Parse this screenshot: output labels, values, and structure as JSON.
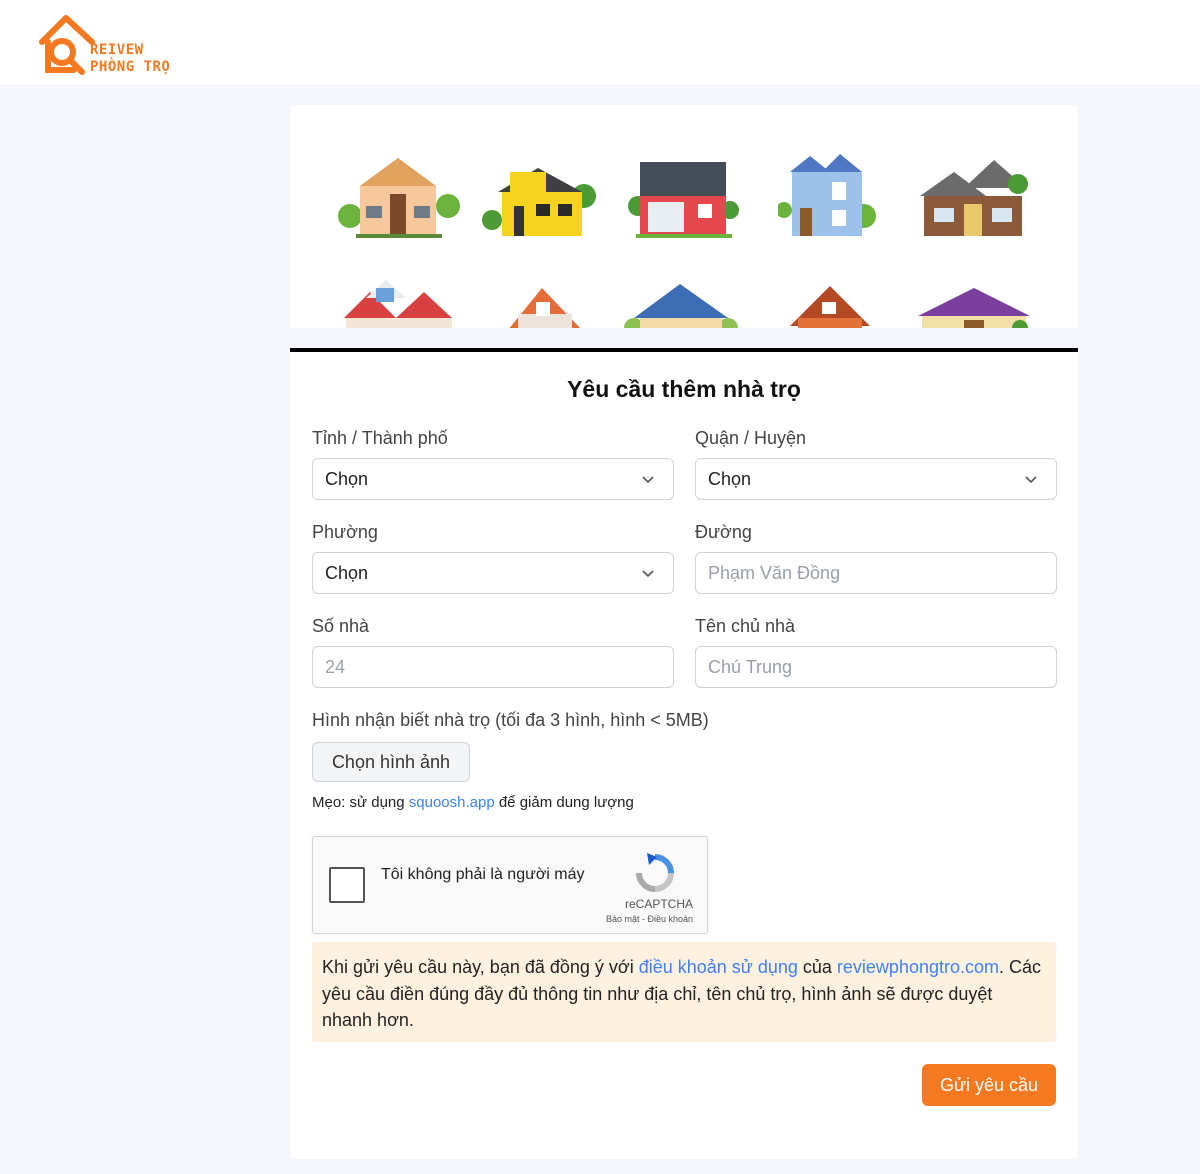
{
  "header": {
    "logo_line1": "REIVEW",
    "logo_line2": "PHÒNG TRỌ"
  },
  "form": {
    "title": "Yêu cầu thêm nhà trọ",
    "province": {
      "label": "Tỉnh / Thành phố",
      "value": "Chọn"
    },
    "district": {
      "label": "Quận / Huyện",
      "value": "Chọn"
    },
    "ward": {
      "label": "Phường",
      "value": "Chọn"
    },
    "street": {
      "label": "Đường",
      "placeholder": "Phạm Văn Đồng"
    },
    "house_number": {
      "label": "Số nhà",
      "placeholder": "24"
    },
    "owner": {
      "label": "Tên chủ nhà",
      "placeholder": "Chú Trung"
    },
    "images": {
      "label": "Hình nhận biết nhà trọ (tối đa 3 hình, hình < 5MB)",
      "button": "Chọn hình ảnh"
    },
    "tip": {
      "prefix": "Mẹo: sử dụng ",
      "link": "squoosh.app",
      "suffix": " để giảm dung lượng"
    },
    "captcha": {
      "text": "Tôi không phải là người máy",
      "brand": "reCAPTCHA",
      "links": "Bảo mật - Điều khoản"
    },
    "notice": {
      "part1": "Khi gửi yêu cầu này, bạn đã đồng ý với ",
      "terms_link": "điều khoản sử dụng",
      "part2": " của ",
      "site_link": "reviewphongtro.com",
      "part3": ". Các yêu cầu điền đúng đầy đủ thông tin như địa chỉ, tên chủ trọ, hình ảnh sẽ được duyệt nhanh hơn."
    },
    "submit": "Gửi yêu cầu"
  },
  "colors": {
    "accent": "#f47920",
    "link": "#3b82f6",
    "notice_bg": "#fff1df"
  },
  "icons": [
    "house-search-logo-icon",
    "chevron-down-icon",
    "recaptcha-icon",
    "house-illustration-icon"
  ]
}
